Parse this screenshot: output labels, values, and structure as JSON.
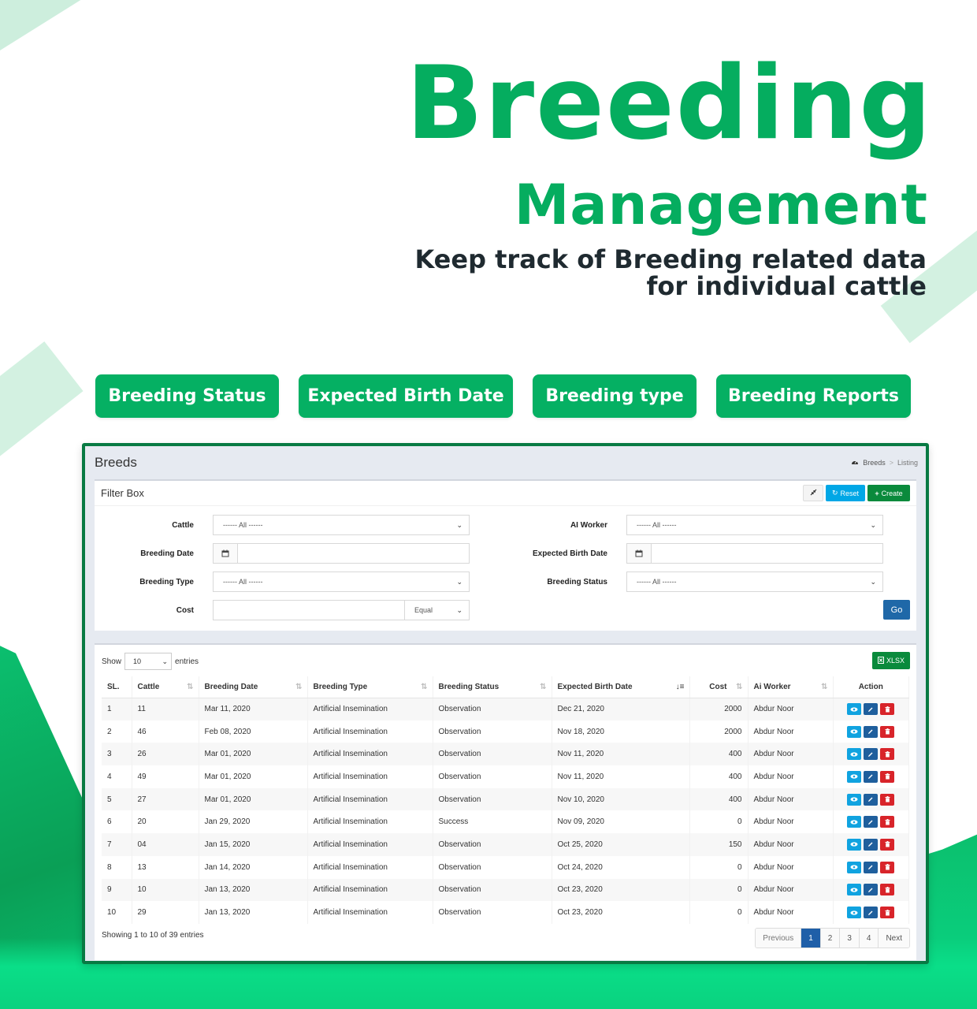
{
  "hero": {
    "title": "Breeding",
    "subtitle": "Management",
    "tagline_line1": "Keep track of Breeding related data",
    "tagline_line2": "for individual cattle"
  },
  "features": [
    {
      "label": "Breeding Status"
    },
    {
      "label": "Expected Birth Date"
    },
    {
      "label": "Breeding type"
    },
    {
      "label": "Breeding Reports"
    }
  ],
  "app": {
    "page_title": "Breeds",
    "breadcrumb": {
      "icon": "dashboard-icon",
      "items": [
        "Breeds",
        "Listing"
      ],
      "separator": ">"
    },
    "filter": {
      "title": "Filter Box",
      "collapse_icon": "compress-icon",
      "reset_label": "Reset",
      "create_label": "Create",
      "fields": {
        "cattle": {
          "label": "Cattle",
          "value": "------ All ------"
        },
        "ai_worker": {
          "label": "AI Worker",
          "value": "------ All ------"
        },
        "breeding_date": {
          "label": "Breeding Date",
          "value": ""
        },
        "expected_birth_date": {
          "label": "Expected Birth Date",
          "value": ""
        },
        "breeding_type": {
          "label": "Breeding Type",
          "value": "------ All ------"
        },
        "breeding_status": {
          "label": "Breeding Status",
          "value": "------ All ------"
        },
        "cost": {
          "label": "Cost",
          "value": "",
          "operator": "Equal"
        }
      },
      "go_label": "Go"
    },
    "list": {
      "show_label": "Show",
      "entries_label": "entries",
      "page_length": "10",
      "export_label": "XLSX",
      "columns": [
        "SL.",
        "Cattle",
        "Breeding Date",
        "Breeding Type",
        "Breeding Status",
        "Expected Birth Date",
        "Cost",
        "Ai Worker",
        "Action"
      ],
      "rows": [
        {
          "sl": "1",
          "cattle": "11",
          "breeding_date": "Mar 11, 2020",
          "type": "Artificial Insemination",
          "status": "Observation",
          "expected": "Dec 21, 2020",
          "cost": "2000",
          "worker": "Abdur Noor"
        },
        {
          "sl": "2",
          "cattle": "46",
          "breeding_date": "Feb 08, 2020",
          "type": "Artificial Insemination",
          "status": "Observation",
          "expected": "Nov 18, 2020",
          "cost": "2000",
          "worker": "Abdur Noor"
        },
        {
          "sl": "3",
          "cattle": "26",
          "breeding_date": "Mar 01, 2020",
          "type": "Artificial Insemination",
          "status": "Observation",
          "expected": "Nov 11, 2020",
          "cost": "400",
          "worker": "Abdur Noor"
        },
        {
          "sl": "4",
          "cattle": "49",
          "breeding_date": "Mar 01, 2020",
          "type": "Artificial Insemination",
          "status": "Observation",
          "expected": "Nov 11, 2020",
          "cost": "400",
          "worker": "Abdur Noor"
        },
        {
          "sl": "5",
          "cattle": "27",
          "breeding_date": "Mar 01, 2020",
          "type": "Artificial Insemination",
          "status": "Observation",
          "expected": "Nov 10, 2020",
          "cost": "400",
          "worker": "Abdur Noor"
        },
        {
          "sl": "6",
          "cattle": "20",
          "breeding_date": "Jan 29, 2020",
          "type": "Artificial Insemination",
          "status": "Success",
          "expected": "Nov 09, 2020",
          "cost": "0",
          "worker": "Abdur Noor"
        },
        {
          "sl": "7",
          "cattle": "04",
          "breeding_date": "Jan 15, 2020",
          "type": "Artificial Insemination",
          "status": "Observation",
          "expected": "Oct 25, 2020",
          "cost": "150",
          "worker": "Abdur Noor"
        },
        {
          "sl": "8",
          "cattle": "13",
          "breeding_date": "Jan 14, 2020",
          "type": "Artificial Insemination",
          "status": "Observation",
          "expected": "Oct 24, 2020",
          "cost": "0",
          "worker": "Abdur Noor"
        },
        {
          "sl": "9",
          "cattle": "10",
          "breeding_date": "Jan 13, 2020",
          "type": "Artificial Insemination",
          "status": "Observation",
          "expected": "Oct 23, 2020",
          "cost": "0",
          "worker": "Abdur Noor"
        },
        {
          "sl": "10",
          "cattle": "29",
          "breeding_date": "Jan 13, 2020",
          "type": "Artificial Insemination",
          "status": "Observation",
          "expected": "Oct 23, 2020",
          "cost": "0",
          "worker": "Abdur Noor"
        }
      ],
      "info": "Showing 1 to 10 of 39 entries",
      "pagination": {
        "previous": "Previous",
        "pages": [
          "1",
          "2",
          "3",
          "4"
        ],
        "current": "1",
        "next": "Next"
      }
    }
  },
  "colors": {
    "brand_green": "#05ad5f",
    "frame_green": "#087a43",
    "reset_blue": "#00a7e6",
    "create_green": "#0a8a3c",
    "go_blue": "#1f68a8",
    "view_blue": "#10a3e0",
    "edit_blue": "#1f5f9d",
    "delete_red": "#d8242a"
  }
}
